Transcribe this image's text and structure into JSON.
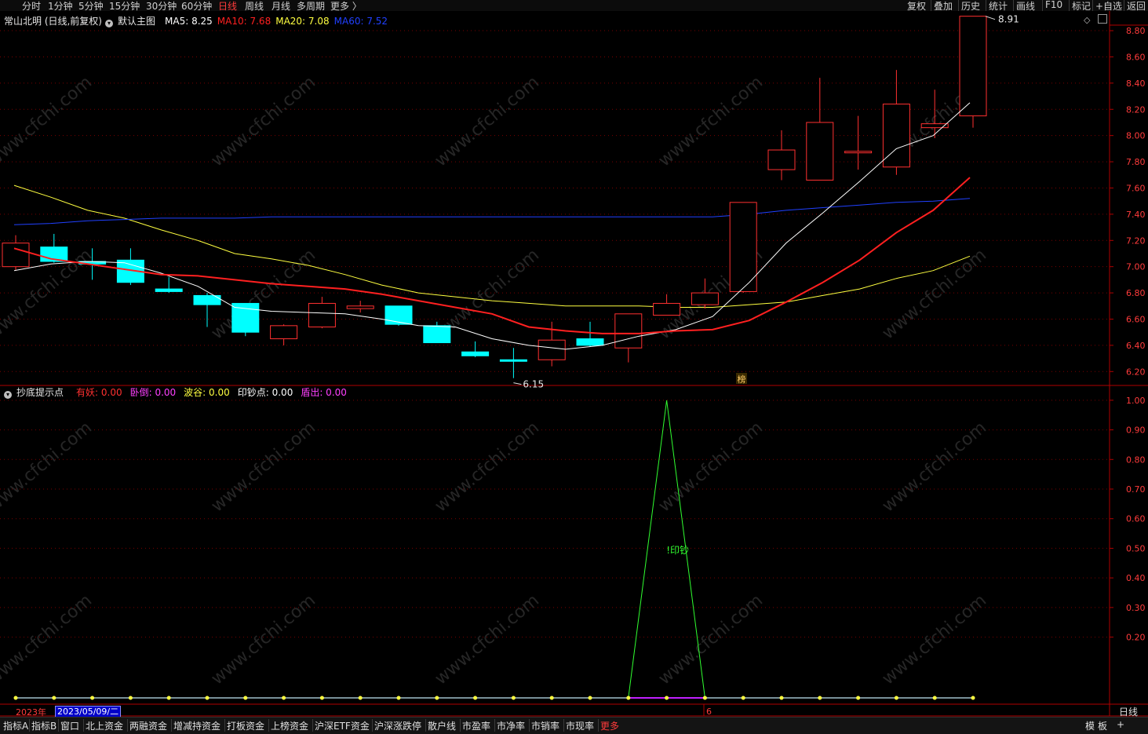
{
  "periods": [
    {
      "label": "分时",
      "active": false
    },
    {
      "label": "1分钟",
      "active": false
    },
    {
      "label": "5分钟",
      "active": false
    },
    {
      "label": "15分钟",
      "active": false
    },
    {
      "label": "30分钟",
      "active": false
    },
    {
      "label": "60分钟",
      "active": false
    },
    {
      "label": "日线",
      "active": true
    },
    {
      "label": "周线",
      "active": false
    },
    {
      "label": "月线",
      "active": false
    },
    {
      "label": "多周期",
      "active": false
    },
    {
      "label": "更多 〉",
      "active": false
    }
  ],
  "toolbar": [
    "复权",
    "叠加",
    "历史",
    "统计",
    "画线",
    "F10",
    "标记",
    "+自选",
    "返回"
  ],
  "main": {
    "stock_title": "常山北明 (日线,前复权)",
    "template": "默认主图",
    "ma": [
      {
        "label": "MA5: 8.25",
        "color": "#ffffff"
      },
      {
        "label": "MA10: 7.68",
        "color": "#ff2020"
      },
      {
        "label": "MA20: 7.08",
        "color": "#ffff40"
      },
      {
        "label": "MA60: 7.52",
        "color": "#2040ff"
      }
    ],
    "high_label": "8.91",
    "low_label": "6.15",
    "bang_label": "榜",
    "yaxis_ticks": [
      "8.80",
      "8.60",
      "8.40",
      "8.20",
      "8.00",
      "7.80",
      "7.60",
      "7.40",
      "7.20",
      "7.00",
      "6.80",
      "6.60",
      "6.40",
      "6.20"
    ]
  },
  "sub": {
    "indicator_name": "抄底提示点",
    "fields": [
      {
        "label": "有妖: 0.00",
        "color": "#ff3030"
      },
      {
        "label": "卧倒: 0.00",
        "color": "#ff40ff"
      },
      {
        "label": "波谷: 0.00",
        "color": "#ffff40"
      },
      {
        "label": "印钞点: 0.00",
        "color": "#ffffff"
      },
      {
        "label": "盾出: 0.00",
        "color": "#ff40ff"
      }
    ],
    "signal_label": "!印钞",
    "yaxis_ticks": [
      "1.00",
      "0.90",
      "0.80",
      "0.70",
      "0.60",
      "0.50",
      "0.40",
      "0.30",
      "0.20"
    ]
  },
  "axis": {
    "year": "2023年",
    "cursor_date": "2023/05/09/二",
    "month_mark": "6",
    "period": "日线"
  },
  "bottom_tabs": [
    "指标A",
    "指标B",
    "窗口",
    "北上资金",
    "两融资金",
    "增减持资金",
    "打板资金",
    "上榜资金",
    "沪深ETF资金",
    "沪深涨跌停",
    "散户线",
    "市盈率",
    "市净率",
    "市销率",
    "市现率",
    "更多"
  ],
  "bottom_right": [
    "模",
    "板",
    "+"
  ],
  "watermark": "www.cfchi.com",
  "colors": {
    "up": "#ff3030",
    "down": "#00ffff",
    "ma5": "#ffffff",
    "ma10": "#ff2020",
    "ma20": "#ffff40",
    "ma60": "#2040ff",
    "signal": "#30ff30",
    "grid": "#7a0000"
  },
  "chart_data": [
    {
      "type": "candlestick",
      "title": "常山北明 (日线,前复权)",
      "ylim": [
        6.1,
        8.95
      ],
      "candles": [
        {
          "o": 7.0,
          "h": 7.24,
          "l": 6.97,
          "c": 7.18
        },
        {
          "o": 7.15,
          "h": 7.25,
          "l": 7.03,
          "c": 7.04
        },
        {
          "o": 7.04,
          "h": 7.14,
          "l": 6.9,
          "c": 7.02
        },
        {
          "o": 7.05,
          "h": 7.14,
          "l": 6.86,
          "c": 6.88
        },
        {
          "o": 6.83,
          "h": 6.92,
          "l": 6.8,
          "c": 6.81
        },
        {
          "o": 6.78,
          "h": 6.8,
          "l": 6.54,
          "c": 6.71
        },
        {
          "o": 6.72,
          "h": 6.72,
          "l": 6.47,
          "c": 6.5
        },
        {
          "o": 6.45,
          "h": 6.56,
          "l": 6.4,
          "c": 6.55
        },
        {
          "o": 6.54,
          "h": 6.77,
          "l": 6.53,
          "c": 6.72
        },
        {
          "o": 6.68,
          "h": 6.74,
          "l": 6.65,
          "c": 6.7
        },
        {
          "o": 6.7,
          "h": 6.7,
          "l": 6.55,
          "c": 6.56
        },
        {
          "o": 6.55,
          "h": 6.58,
          "l": 6.42,
          "c": 6.42
        },
        {
          "o": 6.35,
          "h": 6.43,
          "l": 6.31,
          "c": 6.32
        },
        {
          "o": 6.29,
          "h": 6.38,
          "l": 6.15,
          "c": 6.28
        },
        {
          "o": 6.29,
          "h": 6.58,
          "l": 6.24,
          "c": 6.44
        },
        {
          "o": 6.45,
          "h": 6.58,
          "l": 6.39,
          "c": 6.4
        },
        {
          "o": 6.38,
          "h": 6.63,
          "l": 6.27,
          "c": 6.64
        },
        {
          "o": 6.63,
          "h": 6.79,
          "l": 6.63,
          "c": 6.72
        },
        {
          "o": 6.71,
          "h": 6.91,
          "l": 6.68,
          "c": 6.8
        },
        {
          "o": 6.81,
          "h": 7.49,
          "l": 6.8,
          "c": 7.49
        },
        {
          "o": 7.74,
          "h": 8.04,
          "l": 7.66,
          "c": 7.89
        },
        {
          "o": 7.66,
          "h": 8.44,
          "l": 7.66,
          "c": 8.1
        },
        {
          "o": 7.88,
          "h": 8.15,
          "l": 7.74,
          "c": 7.88
        },
        {
          "o": 7.76,
          "h": 8.5,
          "l": 7.7,
          "c": 8.24
        },
        {
          "o": 8.06,
          "h": 8.35,
          "l": 7.98,
          "c": 8.09
        },
        {
          "o": 8.15,
          "h": 8.91,
          "l": 8.06,
          "c": 8.91
        }
      ],
      "series": [
        {
          "name": "MA5",
          "values": [
            6.97,
            7.02,
            7.04,
            7.03,
            6.95,
            6.85,
            6.69,
            6.66,
            6.65,
            6.64,
            6.6,
            6.55,
            6.54,
            6.45,
            6.4,
            6.37,
            6.4,
            6.47,
            6.52,
            6.62,
            6.88,
            7.18,
            7.41,
            7.65,
            7.9,
            8.0,
            8.25
          ]
        },
        {
          "name": "MA10",
          "values": [
            7.14,
            7.06,
            7.02,
            6.98,
            6.94,
            6.93,
            6.9,
            6.87,
            6.85,
            6.83,
            6.79,
            6.74,
            6.69,
            6.64,
            6.54,
            6.51,
            6.49,
            6.49,
            6.51,
            6.52,
            6.59,
            6.73,
            6.88,
            7.05,
            7.26,
            7.43,
            7.68
          ]
        },
        {
          "name": "MA20",
          "values": [
            7.62,
            7.53,
            7.43,
            7.37,
            7.28,
            7.2,
            7.1,
            7.06,
            7.01,
            6.94,
            6.86,
            6.8,
            6.77,
            6.74,
            6.72,
            6.7,
            6.7,
            6.7,
            6.69,
            6.69,
            6.71,
            6.73,
            6.78,
            6.83,
            6.91,
            6.97,
            7.08
          ]
        },
        {
          "name": "MA60",
          "values": [
            7.32,
            7.33,
            7.35,
            7.36,
            7.37,
            7.37,
            7.37,
            7.38,
            7.38,
            7.38,
            7.38,
            7.38,
            7.38,
            7.38,
            7.38,
            7.38,
            7.38,
            7.38,
            7.38,
            7.38,
            7.4,
            7.43,
            7.45,
            7.47,
            7.49,
            7.5,
            7.52
          ]
        }
      ]
    },
    {
      "type": "line",
      "title": "抄底提示点",
      "ylim": [
        0,
        1.05
      ],
      "series": [
        {
          "name": "印钞点",
          "values": [
            0,
            0,
            0,
            0,
            0,
            0,
            0,
            0,
            0,
            0,
            0,
            0,
            0,
            0,
            0,
            0,
            0,
            1,
            0,
            0,
            0,
            0,
            0,
            0,
            0,
            0
          ]
        }
      ]
    }
  ]
}
